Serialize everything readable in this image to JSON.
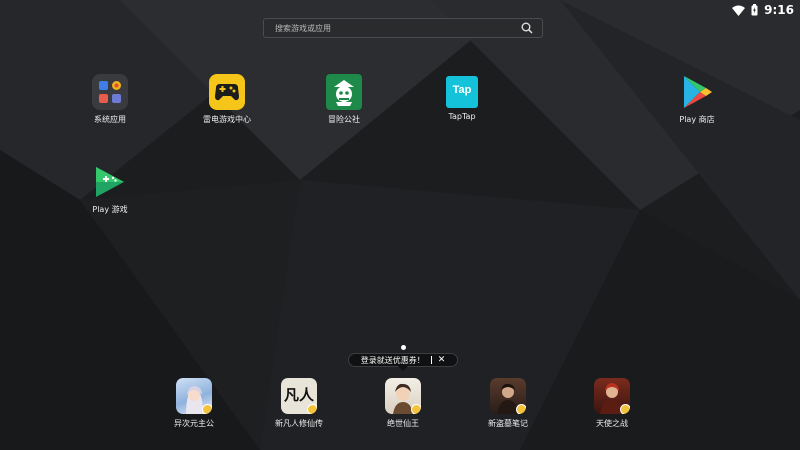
{
  "status_bar": {
    "time": "9:16",
    "wifi_icon": "wifi-icon",
    "battery_icon": "battery-icon"
  },
  "search": {
    "placeholder": "搜索游戏或应用",
    "icon": "search-icon"
  },
  "apps": [
    {
      "label": "系统应用",
      "icon": "system-apps-folder-icon"
    },
    {
      "label": "雷电游戏中心",
      "icon": "game-center-icon"
    },
    {
      "label": "冒险公社",
      "icon": "adventure-club-icon"
    },
    {
      "label": "TapTap",
      "icon": "taptap-icon",
      "icon_text": "Tap"
    },
    {
      "label": "Play 商店",
      "icon": "play-store-icon"
    },
    {
      "label": "Play 游戏",
      "icon": "play-games-icon"
    }
  ],
  "promo": {
    "text": "登录就送优惠券！",
    "close": "✕"
  },
  "dock": [
    {
      "label": "异次元主公"
    },
    {
      "label": "新凡人修仙传",
      "icon_text": "凡人"
    },
    {
      "label": "绝世仙王"
    },
    {
      "label": "新盗墓笔记"
    },
    {
      "label": "天使之战"
    }
  ],
  "colors": {
    "background": "#1d1e20",
    "search_bg": "#2a2b2d",
    "badge": "#f3c43b"
  }
}
